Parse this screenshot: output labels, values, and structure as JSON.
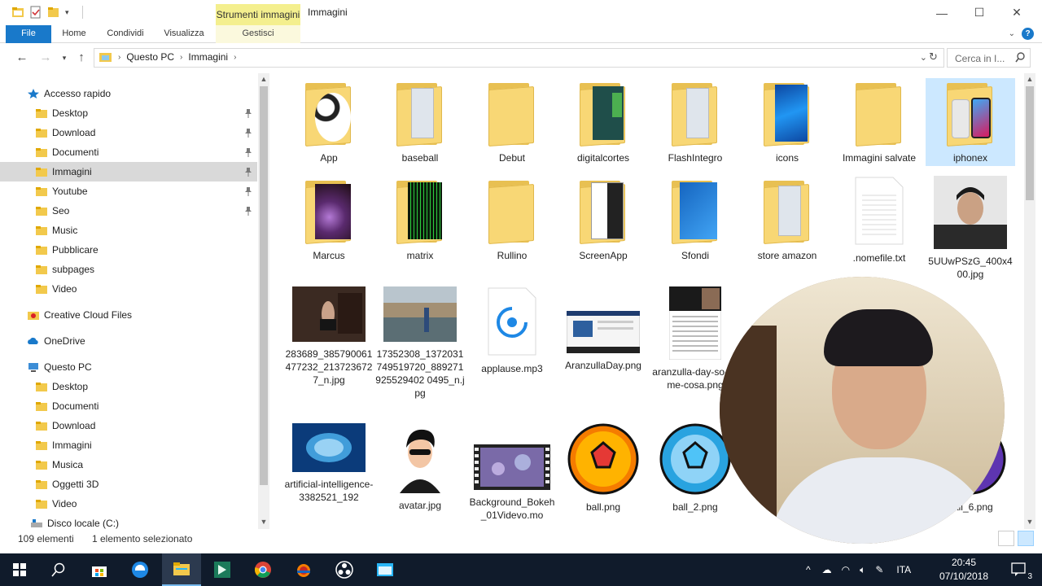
{
  "window": {
    "title": "Immagini",
    "context_tab_head": "Strumenti immagini",
    "controls": {
      "minimize": "—",
      "maximize": "☐",
      "close": "✕"
    }
  },
  "ribbon": {
    "tabs": [
      "File",
      "Home",
      "Condividi",
      "Visualizza"
    ],
    "context_tab": "Gestisci",
    "help": "?"
  },
  "address": {
    "crumbs": [
      "Questo PC",
      "Immagini"
    ],
    "search_placeholder": "Cerca in I..."
  },
  "sidebar": {
    "items": [
      {
        "label": "Accesso rapido",
        "icon": "star-icon",
        "pinned": false
      },
      {
        "label": "Desktop",
        "icon": "desktop-folder-icon",
        "pinned": true
      },
      {
        "label": "Download",
        "icon": "download-folder-icon",
        "pinned": true
      },
      {
        "label": "Documenti",
        "icon": "documents-folder-icon",
        "pinned": true
      },
      {
        "label": "Immagini",
        "icon": "pictures-folder-icon",
        "pinned": true,
        "selected": true
      },
      {
        "label": "Youtube",
        "icon": "folder-icon",
        "pinned": true
      },
      {
        "label": "Seo",
        "icon": "folder-icon",
        "pinned": true
      },
      {
        "label": "Music",
        "icon": "folder-icon",
        "pinned": false
      },
      {
        "label": "Pubblicare",
        "icon": "folder-icon",
        "pinned": false
      },
      {
        "label": "subpages",
        "icon": "folder-icon",
        "pinned": false
      },
      {
        "label": "Video",
        "icon": "video-folder-icon",
        "pinned": false
      },
      {
        "label": "Creative Cloud Files",
        "icon": "creative-cloud-icon",
        "pinned": false
      },
      {
        "label": "OneDrive",
        "icon": "onedrive-icon",
        "pinned": false
      },
      {
        "label": "Questo PC",
        "icon": "computer-icon",
        "pinned": false
      },
      {
        "label": "Desktop",
        "icon": "desktop-folder-icon",
        "pinned": false
      },
      {
        "label": "Documenti",
        "icon": "documents-folder-icon",
        "pinned": false
      },
      {
        "label": "Download",
        "icon": "download-folder-icon",
        "pinned": false
      },
      {
        "label": "Immagini",
        "icon": "pictures-folder-icon",
        "pinned": false
      },
      {
        "label": "Musica",
        "icon": "music-folder-icon",
        "pinned": false
      },
      {
        "label": "Oggetti 3D",
        "icon": "3d-objects-folder-icon",
        "pinned": false
      },
      {
        "label": "Video",
        "icon": "video-folder-icon",
        "pinned": false
      },
      {
        "label": "Disco locale (C:)",
        "icon": "drive-icon",
        "pinned": false
      }
    ]
  },
  "files": [
    {
      "name": "App",
      "kind": "folder",
      "art": "soccer"
    },
    {
      "name": "baseball",
      "kind": "folder",
      "art": "doc"
    },
    {
      "name": "Debut",
      "kind": "folder",
      "art": "none"
    },
    {
      "name": "digitalcortes",
      "kind": "folder",
      "art": "phone"
    },
    {
      "name": "FlashIntegro",
      "kind": "folder",
      "art": "doc"
    },
    {
      "name": "icons",
      "kind": "folder",
      "art": "blue"
    },
    {
      "name": "Immagini salvate",
      "kind": "folder",
      "art": "none"
    },
    {
      "name": "iphonex",
      "kind": "folder",
      "art": "iphone",
      "selected": true
    },
    {
      "name": "Marcus",
      "kind": "folder",
      "art": "purple"
    },
    {
      "name": "matrix",
      "kind": "folder",
      "art": "matrix"
    },
    {
      "name": "Rullino",
      "kind": "folder",
      "art": "none"
    },
    {
      "name": "ScreenApp",
      "kind": "folder",
      "art": "bw"
    },
    {
      "name": "Sfondi",
      "kind": "folder",
      "art": "blue2"
    },
    {
      "name": "store amazon",
      "kind": "folder",
      "art": "doc"
    },
    {
      "name": ".nomefile.txt",
      "kind": "txt"
    },
    {
      "name": "5UUwPSzG_400x400.jpg",
      "kind": "photo-face"
    },
    {
      "name": "283689_385790061477232_2137236727_n.jpg",
      "kind": "photo-room"
    },
    {
      "name": "17352308_1372031749519720_889271925529402 0495_n.jpg",
      "kind": "photo-city"
    },
    {
      "name": "applause.mp3",
      "kind": "mp3"
    },
    {
      "name": "AranzullaDay.png",
      "kind": "screenshot"
    },
    {
      "name": "aranzulla-day-so-come-cosa.png",
      "kind": "article"
    },
    {
      "name": "artificial-intelligence-3382521_192",
      "kind": "photo-brain"
    },
    {
      "name": "avatar.jpg",
      "kind": "avatar"
    },
    {
      "name": "Background_Bokeh_01Videvo.mo",
      "kind": "video"
    },
    {
      "name": "ball.png",
      "kind": "ball-orange"
    },
    {
      "name": "ball_2.png",
      "kind": "ball-blue"
    },
    {
      "name": "ball_6.png",
      "kind": "ball-purple"
    }
  ],
  "status": {
    "count": "109 elementi",
    "selection": "1 elemento selezionato"
  },
  "taskbar": {
    "language": "ITA",
    "time": "20:45",
    "date": "07/10/2018",
    "notifications": "3"
  }
}
